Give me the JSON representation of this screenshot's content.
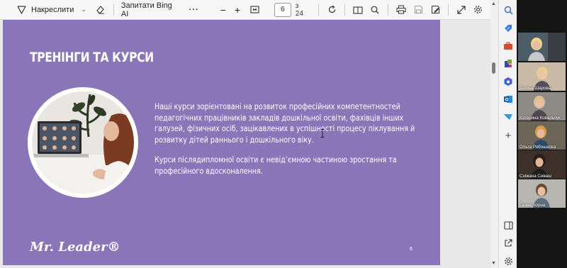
{
  "toolbar": {
    "draw_label": "Накреслити",
    "ask_bing_label": "Запитати Bing AI",
    "page_current": "6",
    "page_of": "з 24"
  },
  "slide": {
    "title": "ТРЕНІНГИ ТА КУРСИ",
    "paragraph1": "Наші курси зорієнтовані на розвиток професійних компетентностей педагогічних працівників закладів дошкільної освіти, фахівців інших галузей, фізичних осіб, зацікавлених в успішності процесу піклування й розвитку дітей раннього і дошкільного віку.",
    "paragraph2": "Курси післядипломної освіти є невід’ємною частиною зростання та професійного вдосконалення.",
    "logo": "Mr. Leader®",
    "page_number": "6",
    "background_color": "#8a75b9"
  },
  "participants": [
    {
      "name": ""
    },
    {
      "name": "Тетяна Шарова"
    },
    {
      "name": "Катерина Ковальчук"
    },
    {
      "name": "Ольга Рябошапка"
    },
    {
      "name": "Сніжана Сиваш"
    },
    {
      "name": "Ганна Чорна"
    }
  ]
}
